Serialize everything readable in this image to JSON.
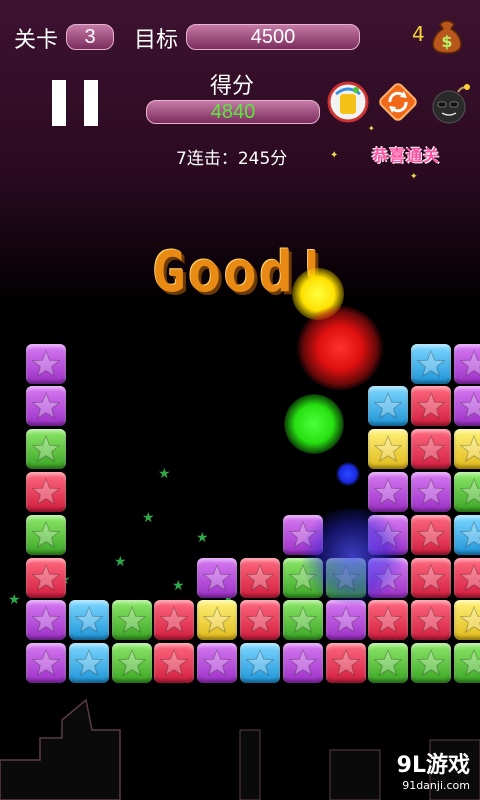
{
  "header": {
    "level_label": "关卡",
    "level_value": "3",
    "target_label": "目标",
    "target_value": "4500",
    "coins": "4"
  },
  "score": {
    "label": "得分",
    "value": "4840",
    "combo_text": "7连击：245分"
  },
  "tools": [
    "paint-bucket-icon",
    "refresh-icon",
    "bomb-icon"
  ],
  "badge_text": "恭喜通关",
  "popup_text": "Good!",
  "watermark": {
    "main": "9L游戏",
    "sub": "91danji.com"
  },
  "colors": {
    "purple": "#b44fe0",
    "red": "#ef3a5a",
    "green": "#5cc43e",
    "yellow": "#f4d43a",
    "blue": "#3cb4ef"
  },
  "board": [
    [
      "purple",
      null,
      null,
      null,
      null,
      null,
      null,
      null,
      null,
      "blue",
      "purple"
    ],
    [
      "purple",
      null,
      null,
      null,
      null,
      null,
      null,
      null,
      "blue",
      "red",
      "purple"
    ],
    [
      "green",
      null,
      null,
      null,
      null,
      null,
      null,
      null,
      "yellow",
      "red",
      "yellow"
    ],
    [
      "red",
      null,
      null,
      null,
      null,
      null,
      null,
      null,
      "purple",
      "purple",
      "green"
    ],
    [
      "green",
      null,
      null,
      null,
      null,
      null,
      "purple",
      null,
      "purple",
      "red",
      "blue"
    ],
    [
      "red",
      null,
      null,
      null,
      "purple",
      "red",
      "green",
      "green",
      "purple",
      "red",
      "red"
    ],
    [
      "purple",
      "blue",
      "green",
      "red",
      "yellow",
      "red",
      "green",
      "purple",
      "red",
      "red",
      "yellow"
    ],
    [
      "purple",
      "blue",
      "green",
      "red",
      "purple",
      "blue",
      "purple",
      "red",
      "green",
      "green",
      "green"
    ]
  ]
}
